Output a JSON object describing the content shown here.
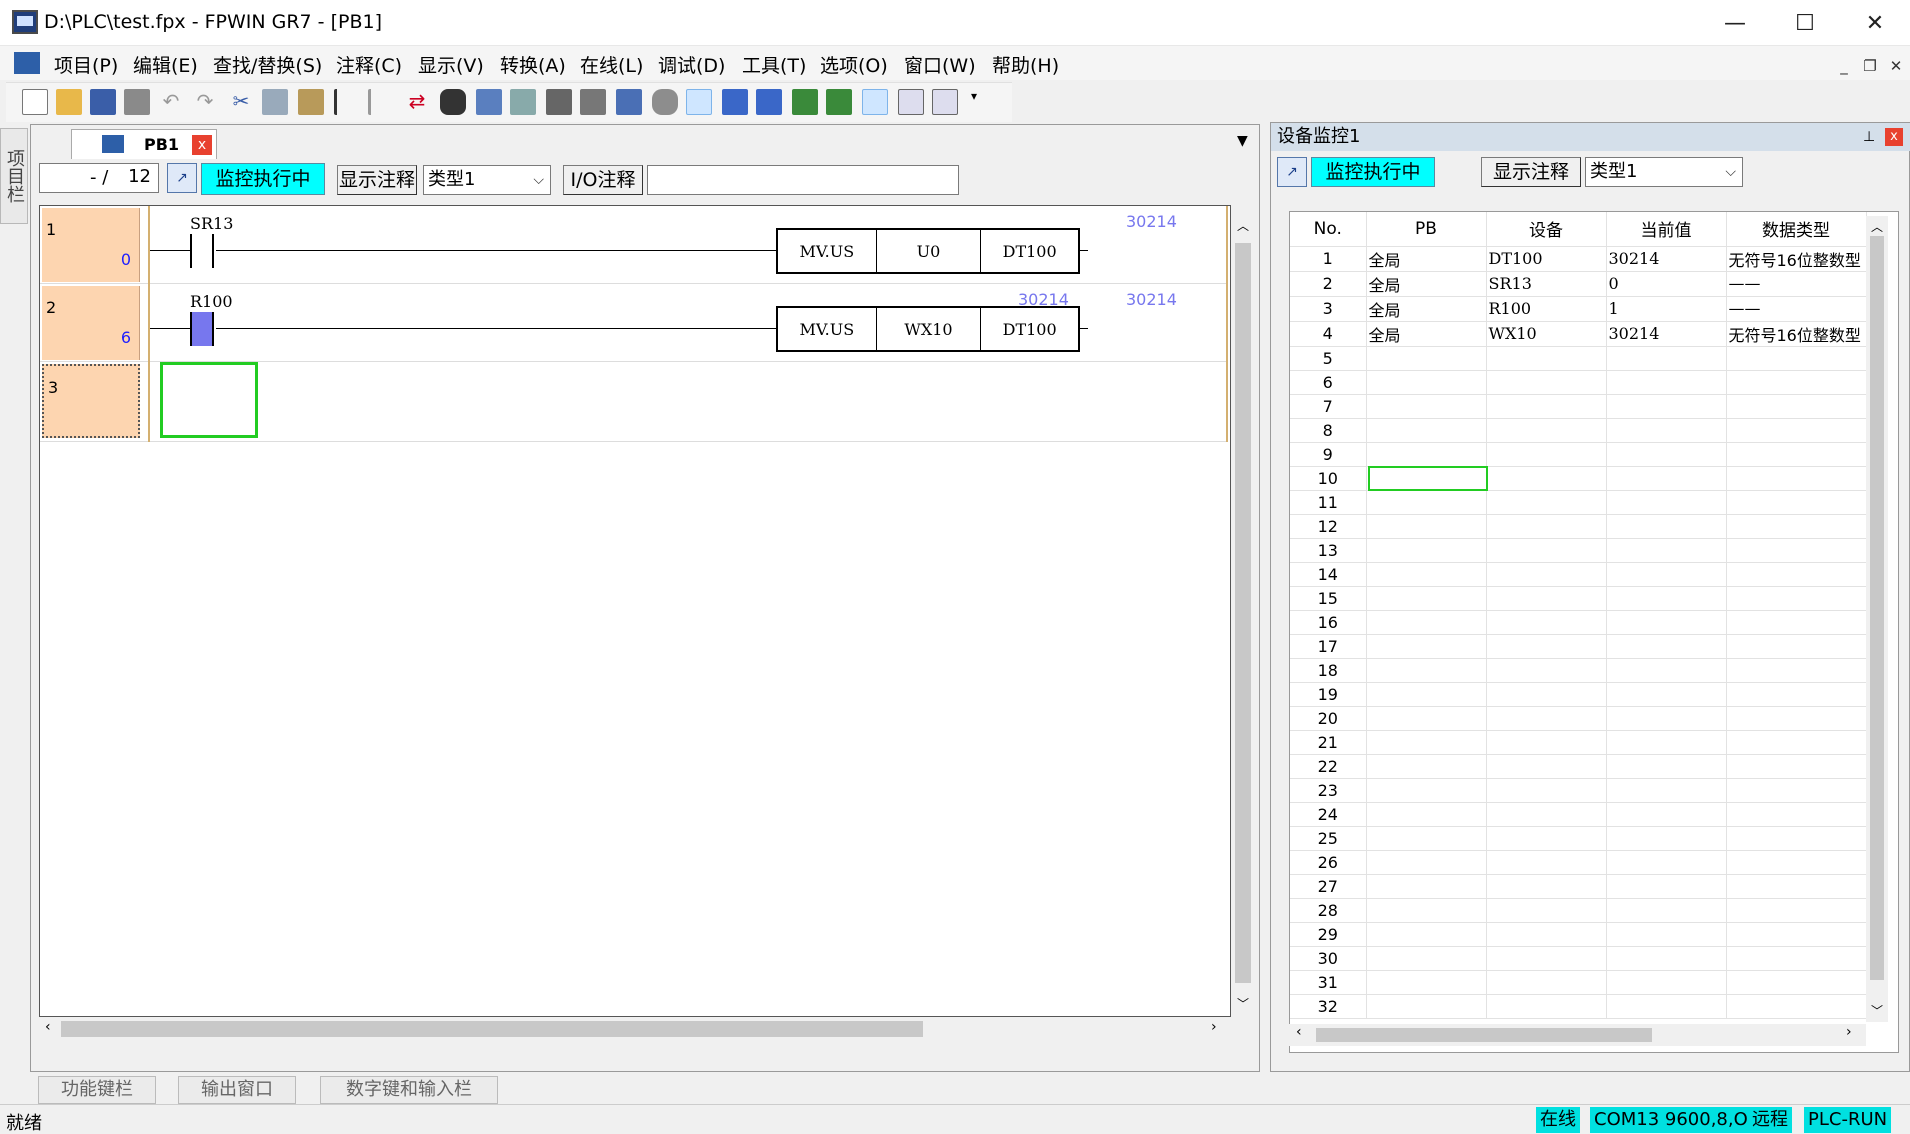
{
  "window": {
    "title": "D:\\PLC\\test.fpx - FPWIN GR7 - [PB1]"
  },
  "menu": [
    "项目(P)",
    "编辑(E)",
    "查找/替换(S)",
    "注释(C)",
    "显示(V)",
    "转换(A)",
    "在线(L)",
    "调试(D)",
    "工具(T)",
    "选项(O)",
    "窗口(W)",
    "帮助(H)"
  ],
  "sidetab": "项目栏",
  "editor": {
    "tab_label": "PB1",
    "position": "- /",
    "total": "12",
    "monitor_label": "监控执行中",
    "show_comment": "显示注释",
    "type_select": "类型1",
    "io_comment": "I/O注释",
    "rows": [
      {
        "num": "1",
        "addr": "0",
        "device": "SR13",
        "contact_on": false,
        "instr": "MV.US",
        "op1": "U0",
        "op2": "DT100",
        "mon_op1": "",
        "mon_op2": "30214"
      },
      {
        "num": "2",
        "addr": "6",
        "device": "R100",
        "contact_on": true,
        "instr": "MV.US",
        "op1": "WX10",
        "op2": "DT100",
        "mon_op1": "30214",
        "mon_op2": "30214"
      },
      {
        "num": "3",
        "addr": ""
      }
    ]
  },
  "bottom_tabs": [
    "功能键栏",
    "输出窗口",
    "数字键和输入栏"
  ],
  "monitor": {
    "title": "设备监控1",
    "monitor_label": "监控执行中",
    "show_comment": "显示注释",
    "type_select": "类型1",
    "headers": [
      "No.",
      "PB",
      "设备",
      "当前值",
      "数据类型"
    ],
    "rows": [
      {
        "no": "1",
        "pb": "全局",
        "dev": "DT100",
        "val": "30214",
        "type": "无符号16位整数型"
      },
      {
        "no": "2",
        "pb": "全局",
        "dev": "SR13",
        "val": "0",
        "type": "——"
      },
      {
        "no": "3",
        "pb": "全局",
        "dev": "R100",
        "val": "1",
        "type": "——"
      },
      {
        "no": "4",
        "pb": "全局",
        "dev": "WX10",
        "val": "30214",
        "type": "无符号16位整数型"
      },
      {
        "no": "5"
      },
      {
        "no": "6"
      },
      {
        "no": "7"
      },
      {
        "no": "8"
      },
      {
        "no": "9"
      },
      {
        "no": "10"
      },
      {
        "no": "11"
      },
      {
        "no": "12"
      },
      {
        "no": "13"
      },
      {
        "no": "14"
      },
      {
        "no": "15"
      },
      {
        "no": "16"
      },
      {
        "no": "17"
      },
      {
        "no": "18"
      },
      {
        "no": "19"
      },
      {
        "no": "20"
      },
      {
        "no": "21"
      },
      {
        "no": "22"
      },
      {
        "no": "23"
      },
      {
        "no": "24"
      },
      {
        "no": "25"
      },
      {
        "no": "26"
      },
      {
        "no": "27"
      },
      {
        "no": "28"
      },
      {
        "no": "29"
      },
      {
        "no": "30"
      },
      {
        "no": "31"
      },
      {
        "no": "32"
      }
    ]
  },
  "status": {
    "text": "就绪",
    "online": "在线",
    "com": "COM13 9600,8,O,1",
    "remote": "远程",
    "plc": "PLC-RUN"
  }
}
